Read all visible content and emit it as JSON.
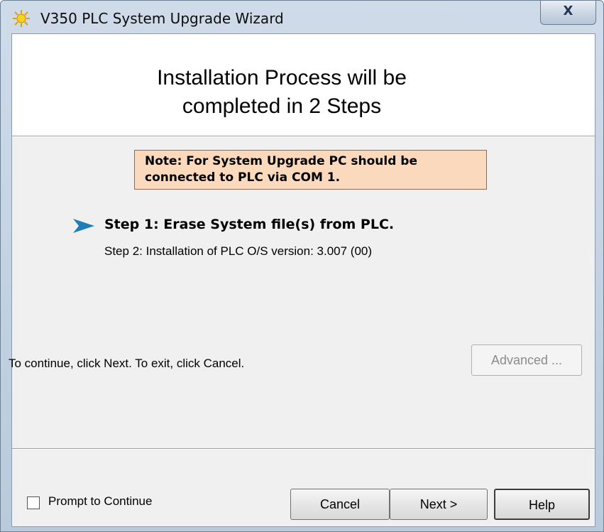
{
  "window": {
    "title": "V350 PLC System Upgrade Wizard",
    "close_label": "X"
  },
  "header": {
    "title": "Installation Process will be\ncompleted in 2 Steps"
  },
  "note": {
    "text": "Note: For System Upgrade PC should be\nconnected to PLC via COM 1."
  },
  "steps": [
    {
      "label": "Step 1: Erase System file(s) from PLC.",
      "current": true
    },
    {
      "label": "Step 2: Installation of PLC O/S version: 3.007 (00)",
      "current": false
    }
  ],
  "instruction": "To continue, click Next. To exit, click Cancel.",
  "buttons": {
    "advanced": "Advanced ...",
    "cancel": "Cancel",
    "next": "Next >",
    "help": "Help"
  },
  "prompt_checkbox": {
    "label": "Prompt to Continue",
    "checked": false
  },
  "colors": {
    "note_background": "#fbd9bd",
    "step_arrow": "#1e7fb8"
  },
  "icons": {
    "app": "sun-icon",
    "step_pointer": "arrow-right-icon"
  }
}
